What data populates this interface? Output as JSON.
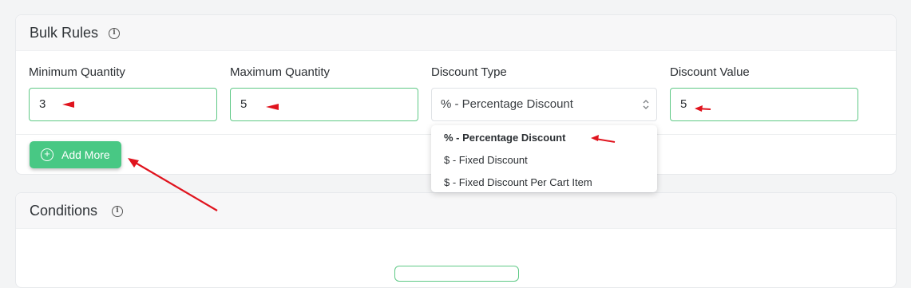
{
  "bulk_rules": {
    "title": "Bulk Rules",
    "fields": {
      "min_quantity": {
        "label": "Minimum Quantity",
        "value": "3"
      },
      "max_quantity": {
        "label": "Maximum Quantity",
        "value": "5"
      },
      "discount_type": {
        "label": "Discount Type",
        "value": "% - Percentage Discount"
      },
      "discount_value": {
        "label": "Discount Value",
        "value": "5"
      }
    },
    "add_more_label": "Add More",
    "discount_type_options": [
      "% - Percentage Discount",
      "$ - Fixed Discount",
      "$ - Fixed Discount Per Cart Item"
    ]
  },
  "conditions": {
    "title": "Conditions"
  },
  "colors": {
    "accent": "#48c884",
    "annotation_arrow": "#e0141e",
    "field_border": "#5fc986"
  },
  "icons": [
    "info-icon",
    "plus-circle-icon",
    "select-arrows-icon"
  ]
}
